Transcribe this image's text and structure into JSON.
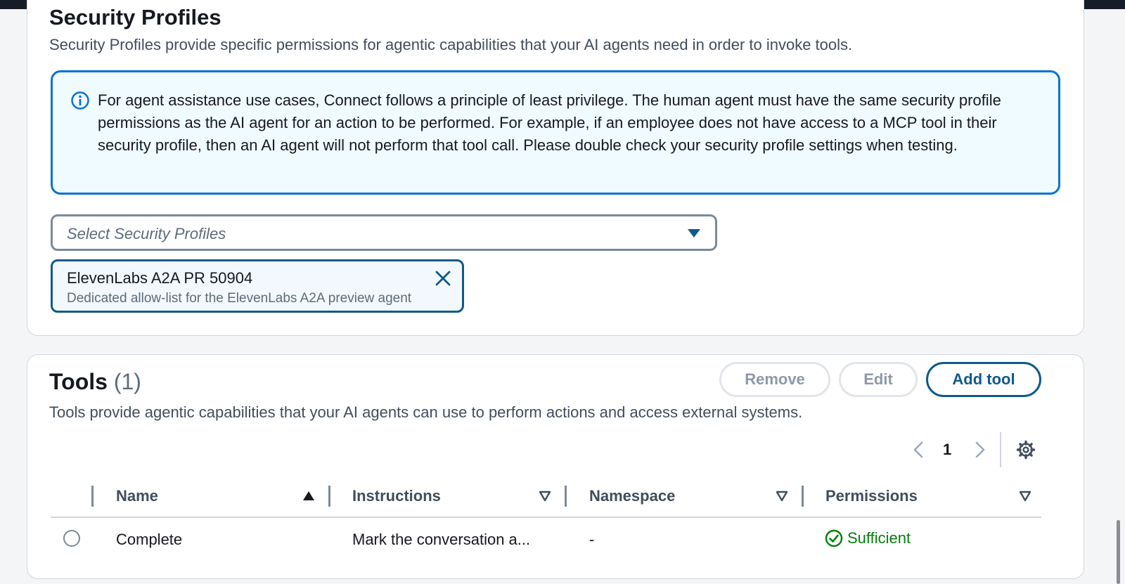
{
  "security_profiles": {
    "title": "Security Profiles",
    "description": "Security Profiles provide specific permissions for agentic capabilities that your AI agents need in order to invoke tools.",
    "info_text": "For agent assistance use cases, Connect follows a principle of least privilege. The human agent must have the same security profile permissions as the AI agent for an action to be performed. For example, if an employee does not have access to a MCP tool in their security profile, then an AI agent will not perform that tool call. Please double check your security profile settings when testing.",
    "select_placeholder": "Select Security Profiles",
    "selected_token": {
      "name": "ElevenLabs A2A PR 50904",
      "description": "Dedicated allow-list for the ElevenLabs A2A preview agent"
    }
  },
  "tools": {
    "title": "Tools",
    "count": "(1)",
    "description": "Tools provide agentic capabilities that your AI agents can use to perform actions and access external systems.",
    "buttons": {
      "remove": "Remove",
      "edit": "Edit",
      "add": "Add tool"
    },
    "pagination": {
      "current_page": "1"
    },
    "columns": [
      "Name",
      "Instructions",
      "Namespace",
      "Permissions"
    ],
    "rows": [
      {
        "name": "Complete",
        "instructions": "Mark the conversation a...",
        "namespace": "-",
        "permissions": "Sufficient"
      }
    ]
  },
  "colors": {
    "info_border": "#0972d3",
    "primary": "#0f5a8a",
    "success": "#037f0c"
  },
  "icons": [
    "info-icon",
    "caret-down-icon",
    "close-icon",
    "chevron-left-icon",
    "chevron-right-icon",
    "settings-gear-icon",
    "sort-ascending-icon",
    "sort-descending-icon",
    "check-circle-icon"
  ]
}
